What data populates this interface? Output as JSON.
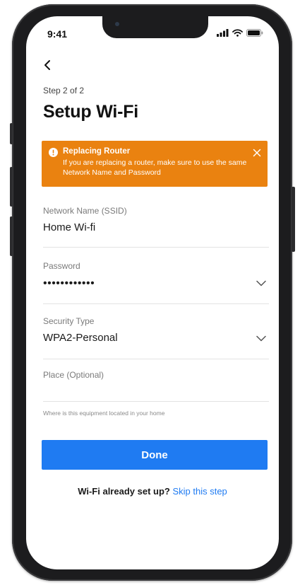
{
  "status_bar": {
    "time": "9:41"
  },
  "header": {
    "step": "Step 2 of 2",
    "title": "Setup Wi-Fi"
  },
  "banner": {
    "title": "Replacing Router",
    "message": "If you are replacing a router, make sure to use the same Network Name and Password",
    "color": "#ea8210"
  },
  "form": {
    "ssid": {
      "label": "Network Name (SSID)",
      "value": "Home Wi-fi"
    },
    "password": {
      "label": "Password",
      "value": "••••••••••••"
    },
    "security": {
      "label": "Security Type",
      "value": "WPA2-Personal"
    },
    "place": {
      "label": "Place (Optional)",
      "hint": "Where is this equipment located in your home"
    }
  },
  "actions": {
    "done_label": "Done",
    "skip_prompt": "Wi-Fi already set up?",
    "skip_link": "Skip this step",
    "accent": "#1f7bf2"
  }
}
